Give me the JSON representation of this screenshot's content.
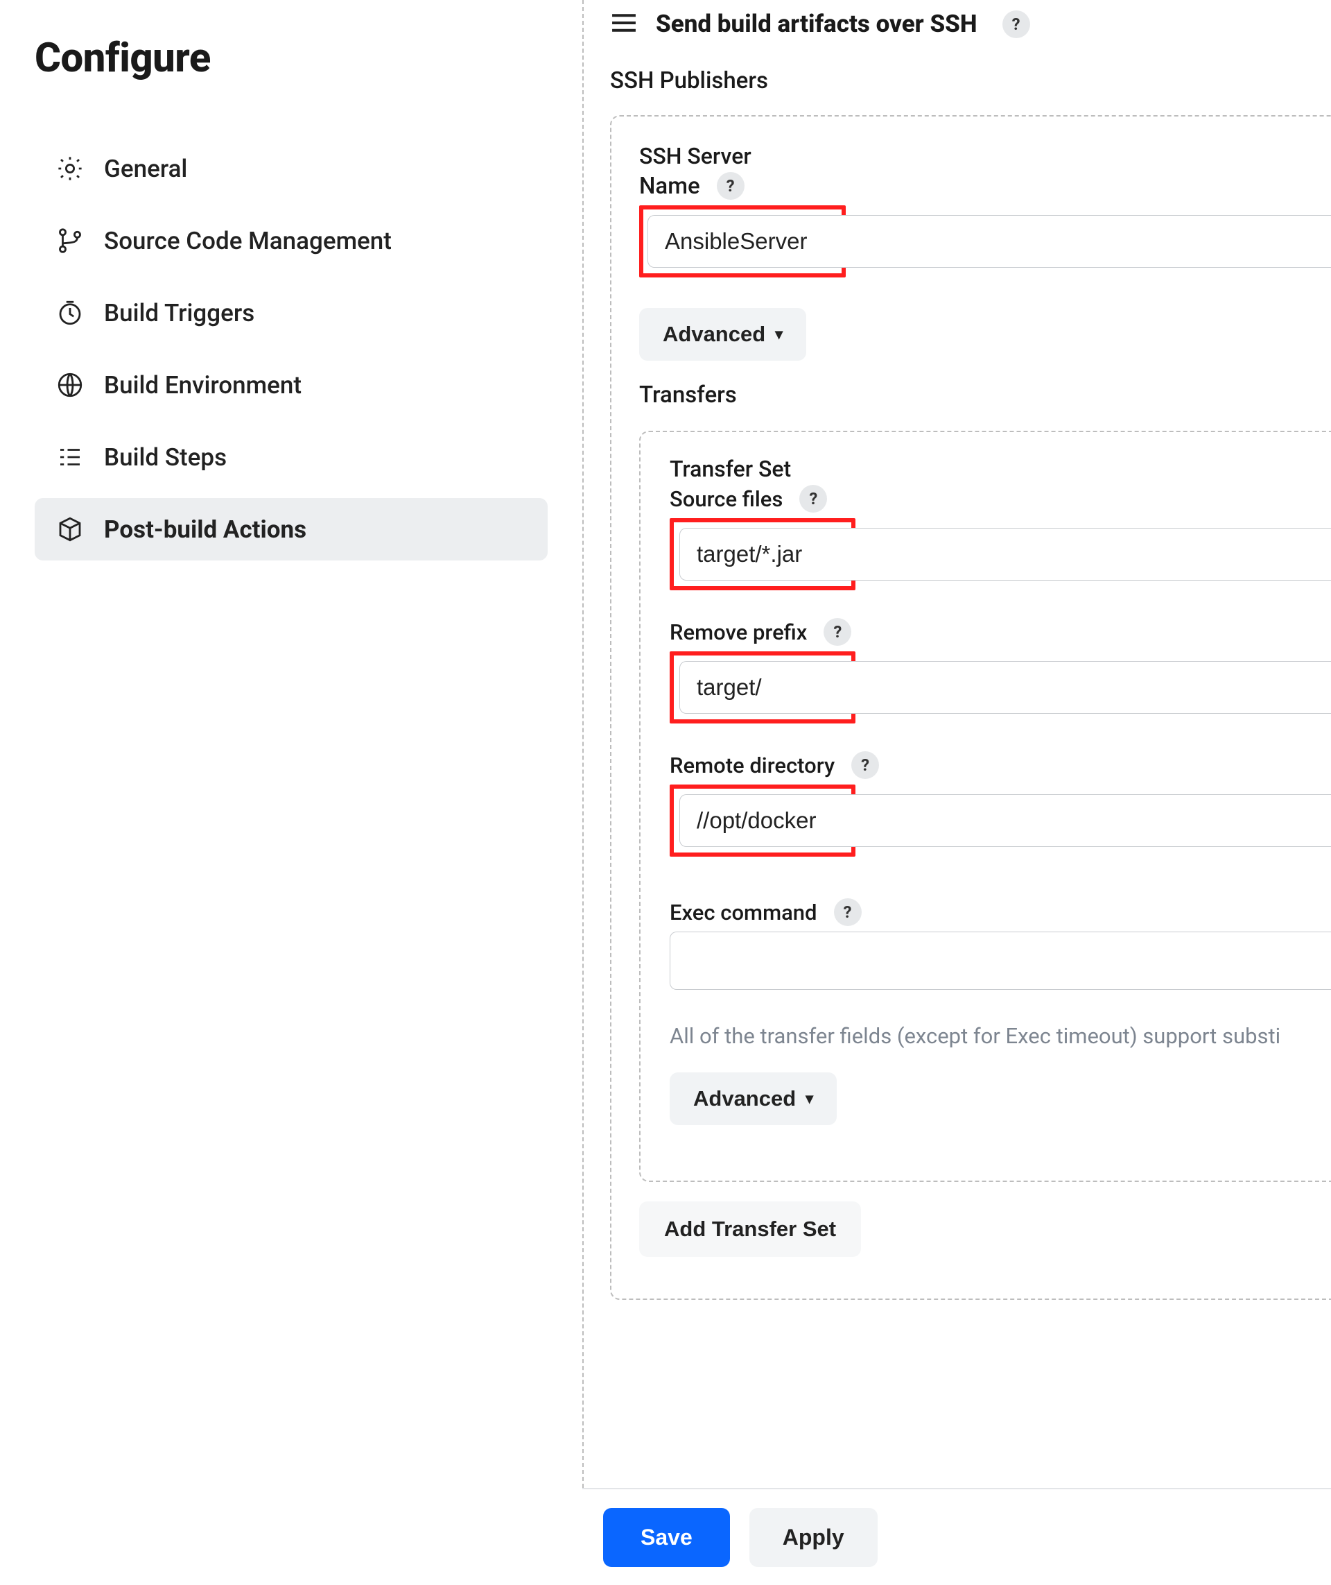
{
  "sidebar": {
    "title": "Configure",
    "items": [
      {
        "id": "general",
        "label": "General",
        "icon": "gear-icon"
      },
      {
        "id": "scm",
        "label": "Source Code Management",
        "icon": "branch-icon"
      },
      {
        "id": "triggers",
        "label": "Build Triggers",
        "icon": "clock-icon"
      },
      {
        "id": "env",
        "label": "Build Environment",
        "icon": "globe-icon"
      },
      {
        "id": "steps",
        "label": "Build Steps",
        "icon": "steps-icon"
      },
      {
        "id": "postbuild",
        "label": "Post-build Actions",
        "icon": "box-icon"
      }
    ],
    "active": "postbuild"
  },
  "main": {
    "section_title": "Send build artifacts over SSH",
    "subheader": "SSH Publishers",
    "ssh_server": {
      "group_label": "SSH Server",
      "name_label": "Name",
      "name_value": "AnsibleServer",
      "advanced_label": "Advanced"
    },
    "transfers_label": "Transfers",
    "transfer_set": {
      "group_label": "Transfer Set",
      "source_files_label": "Source files",
      "source_files_value": "target/*.jar",
      "remove_prefix_label": "Remove prefix",
      "remove_prefix_value": "target/",
      "remote_dir_label": "Remote directory",
      "remote_dir_value": "//opt/docker",
      "exec_command_label": "Exec command",
      "exec_command_value": "",
      "hint": "All of the transfer fields (except for Exec timeout) support substi",
      "advanced_label": "Advanced"
    },
    "add_transfer_label": "Add Transfer Set"
  },
  "footer": {
    "save": "Save",
    "apply": "Apply"
  },
  "help_glyph": "?"
}
